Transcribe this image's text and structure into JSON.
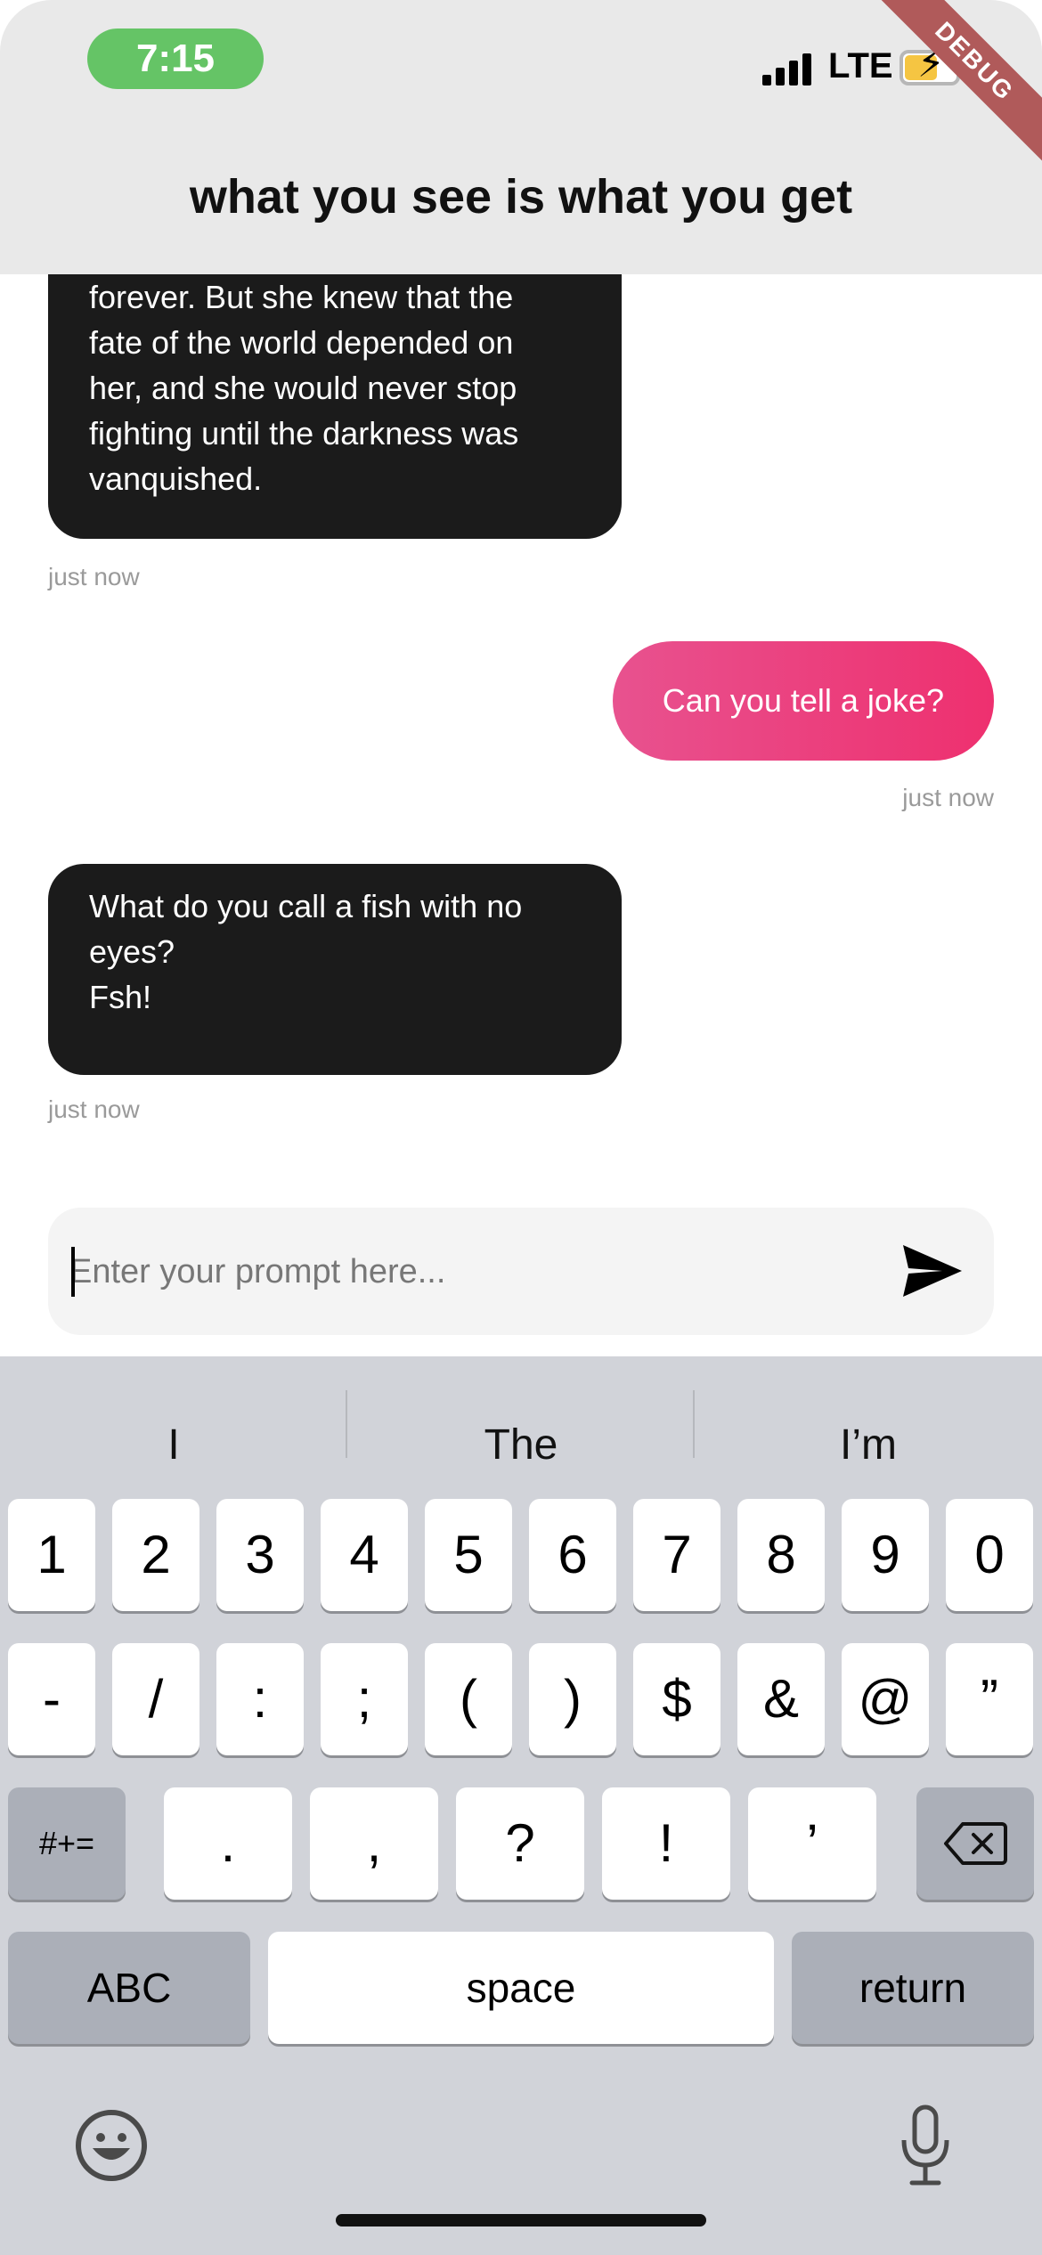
{
  "status_bar": {
    "time": "7:15",
    "network": "LTE",
    "debug_label": "DEBUG"
  },
  "header": {
    "title": "what you see is what you get"
  },
  "messages": [
    {
      "role": "assistant",
      "lines": [
        "forever. But she knew that the",
        "fate of the world depended on",
        "her, and she would never stop",
        "fighting until the darkness was",
        "vanquished."
      ],
      "time": "just now"
    },
    {
      "role": "user",
      "text": "Can you tell a joke?",
      "time": "just now"
    },
    {
      "role": "assistant",
      "lines": [
        "What do you call a fish with no",
        "eyes?",
        "Fsh!"
      ],
      "time": "just now"
    }
  ],
  "input": {
    "placeholder": "Enter your prompt here..."
  },
  "keyboard": {
    "suggestions": [
      "I",
      "The",
      "I’m"
    ],
    "row1": [
      "1",
      "2",
      "3",
      "4",
      "5",
      "6",
      "7",
      "8",
      "9",
      "0"
    ],
    "row2": [
      "-",
      "/",
      ":",
      ";",
      "(",
      ")",
      "$",
      "&",
      "@",
      "”"
    ],
    "row3_toggle": "#+=",
    "row3": [
      ".",
      ",",
      "?",
      "!",
      "’"
    ],
    "abc": "ABC",
    "space": "space",
    "return": "return"
  },
  "colors": {
    "accent_start": "#e8528f",
    "accent_end": "#ee306f",
    "assistant_bubble": "#1b1b1b",
    "time_pill": "#65c466"
  }
}
